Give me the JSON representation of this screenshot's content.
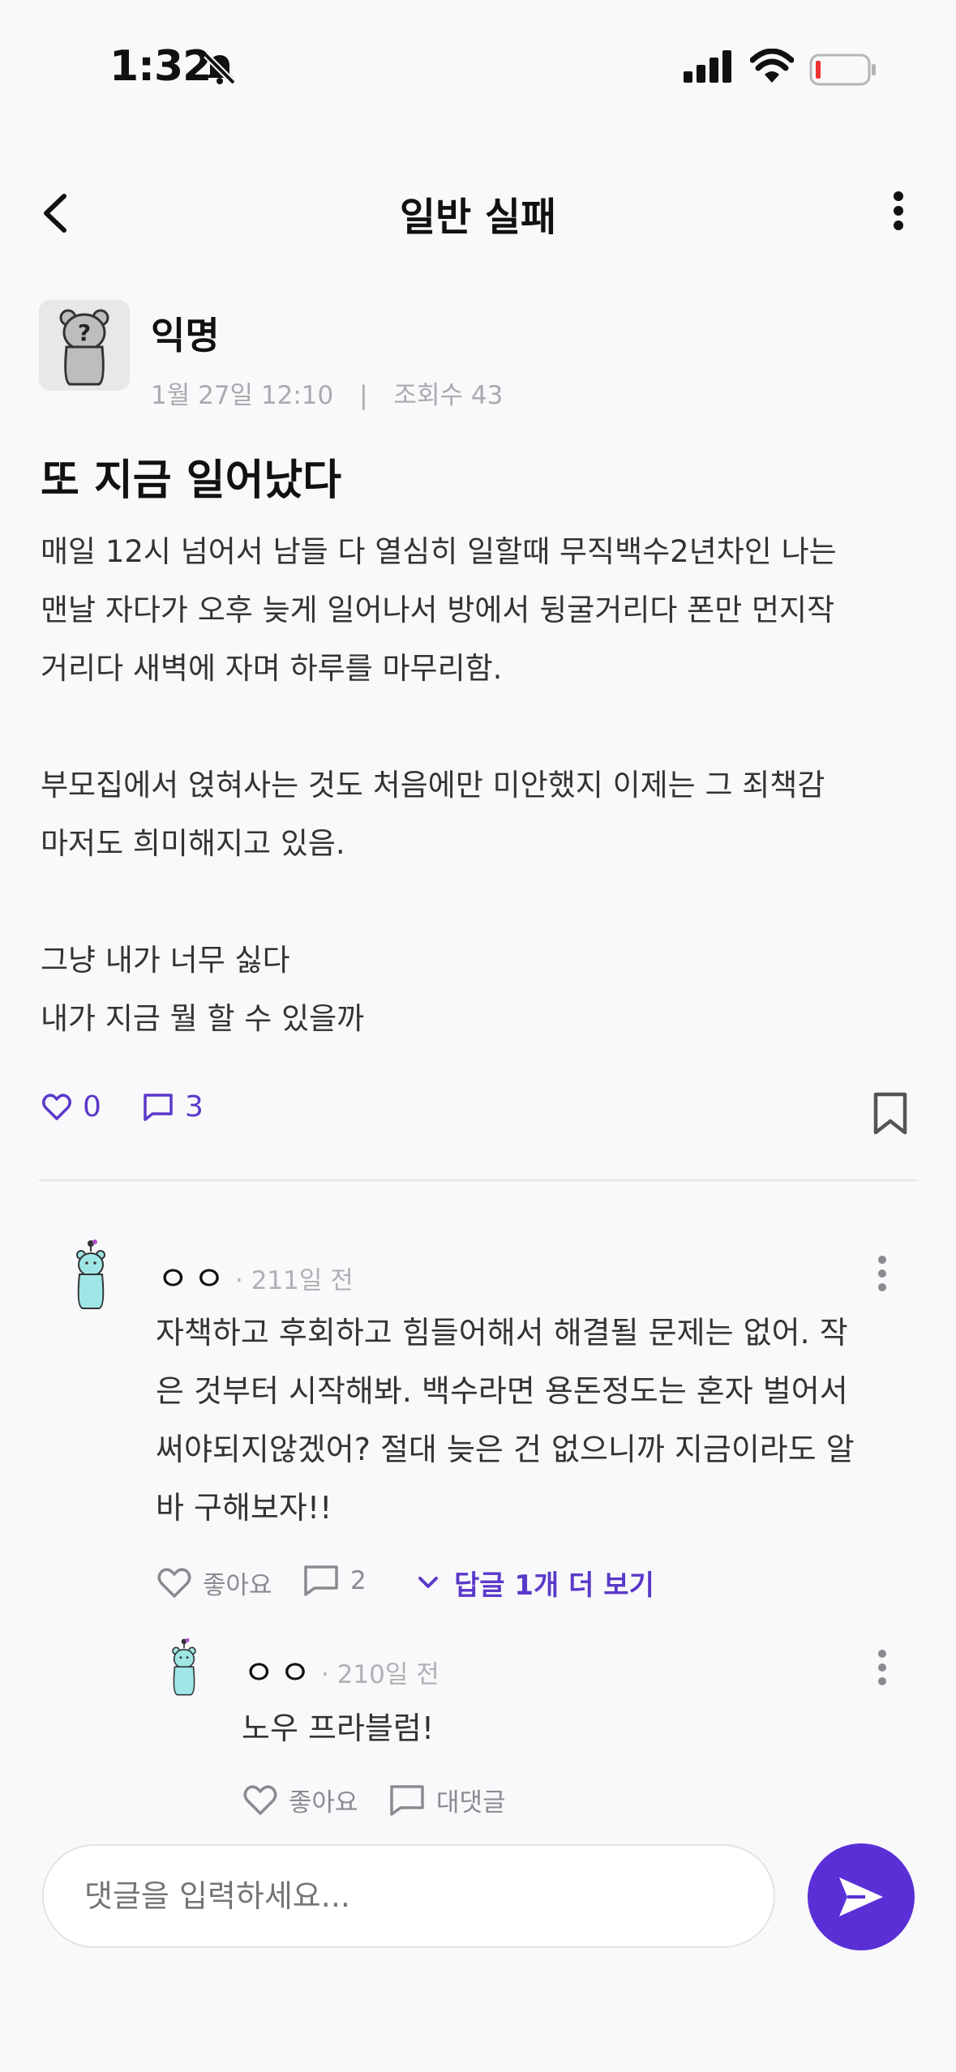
{
  "status_bar": {
    "time": "1:32"
  },
  "header": {
    "title": "일반 실패"
  },
  "post": {
    "author": "익명",
    "date": "1월 27일 12:10",
    "separator": "|",
    "views": "조회수 43",
    "title": "또 지금 일어났다",
    "body": "매일 12시 넘어서 남들 다 열심히 일할때 무직백수2년차인 나는\n맨날 자다가 오후 늦게 일어나서 방에서 뒹굴거리다 폰만 먼지작\n거리다 새벽에 자며 하루를 마무리함.\n\n부모집에서 얹혀사는 것도 처음에만 미안했지 이제는 그 죄책감\n마저도 희미해지고 있음.\n\n그냥 내가 너무 싫다\n내가 지금 뭘 할 수 있을까",
    "likes": "0",
    "comments": "3"
  },
  "comments": [
    {
      "name": "ㅇㅇ",
      "date": "· 211일 전",
      "text": "자책하고 후회하고 힘들어해서 해결될 문제는 없어. 작\n은 것부터 시작해봐. 백수라면 용돈정도는 혼자 벌어서\n써야되지않겠어? 절대 늦은 건 없으니까 지금이라도 알\n바 구해보자!!",
      "like_label": "좋아요",
      "reply_count": "2",
      "more_replies": "답글 1개 더 보기"
    },
    {
      "name": "ㅇㅇ",
      "date": "· 210일 전",
      "text": "노우 프라블럼!",
      "like_label": "좋아요",
      "reply_label": "대댓글"
    }
  ],
  "composer": {
    "placeholder": "댓글을 입력하세요..."
  },
  "colors": {
    "accent": "#5a2fd6",
    "background": "#f9f9fb",
    "mascot": "#9fe6e6"
  }
}
